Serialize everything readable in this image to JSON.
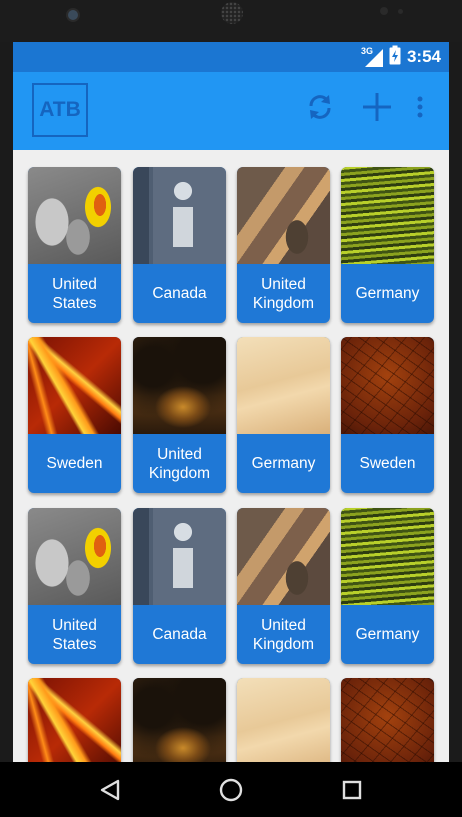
{
  "status_bar": {
    "network_label": "3G",
    "time": "3:54",
    "icons": [
      "signal-icon",
      "battery-charging-icon"
    ]
  },
  "app_bar": {
    "logo_text": "ATB",
    "actions": [
      "refresh-icon",
      "add-icon",
      "overflow-menu-icon"
    ]
  },
  "colors": {
    "status_bar": "#1b76d2",
    "app_bar": "#2196f3",
    "tile_label_bg": "#1f78d6",
    "logo": "#1565c0"
  },
  "grid": {
    "tiles": [
      {
        "label": "United\nStates",
        "image": "gray-yellow-abstract"
      },
      {
        "label": "Canada",
        "image": "info-sign"
      },
      {
        "label": "United\nKingdom",
        "image": "colored-pencils"
      },
      {
        "label": "Germany",
        "image": "green-water"
      },
      {
        "label": "Sweden",
        "image": "orange-red-abstract"
      },
      {
        "label": "United\nKingdom",
        "image": "tree-sunset"
      },
      {
        "label": "Germany",
        "image": "beige-sky"
      },
      {
        "label": "Sweden",
        "image": "bare-branches-red"
      },
      {
        "label": "United\nStates",
        "image": "gray-yellow-abstract"
      },
      {
        "label": "Canada",
        "image": "info-sign"
      },
      {
        "label": "United\nKingdom",
        "image": "colored-pencils"
      },
      {
        "label": "Germany",
        "image": "green-water"
      },
      {
        "label": "",
        "image": "orange-red-abstract"
      },
      {
        "label": "",
        "image": "tree-sunset"
      },
      {
        "label": "",
        "image": "beige-sky"
      },
      {
        "label": "",
        "image": "bare-branches-red"
      }
    ]
  },
  "nav_bar": {
    "buttons": [
      "back-icon",
      "home-icon",
      "recents-icon"
    ]
  }
}
